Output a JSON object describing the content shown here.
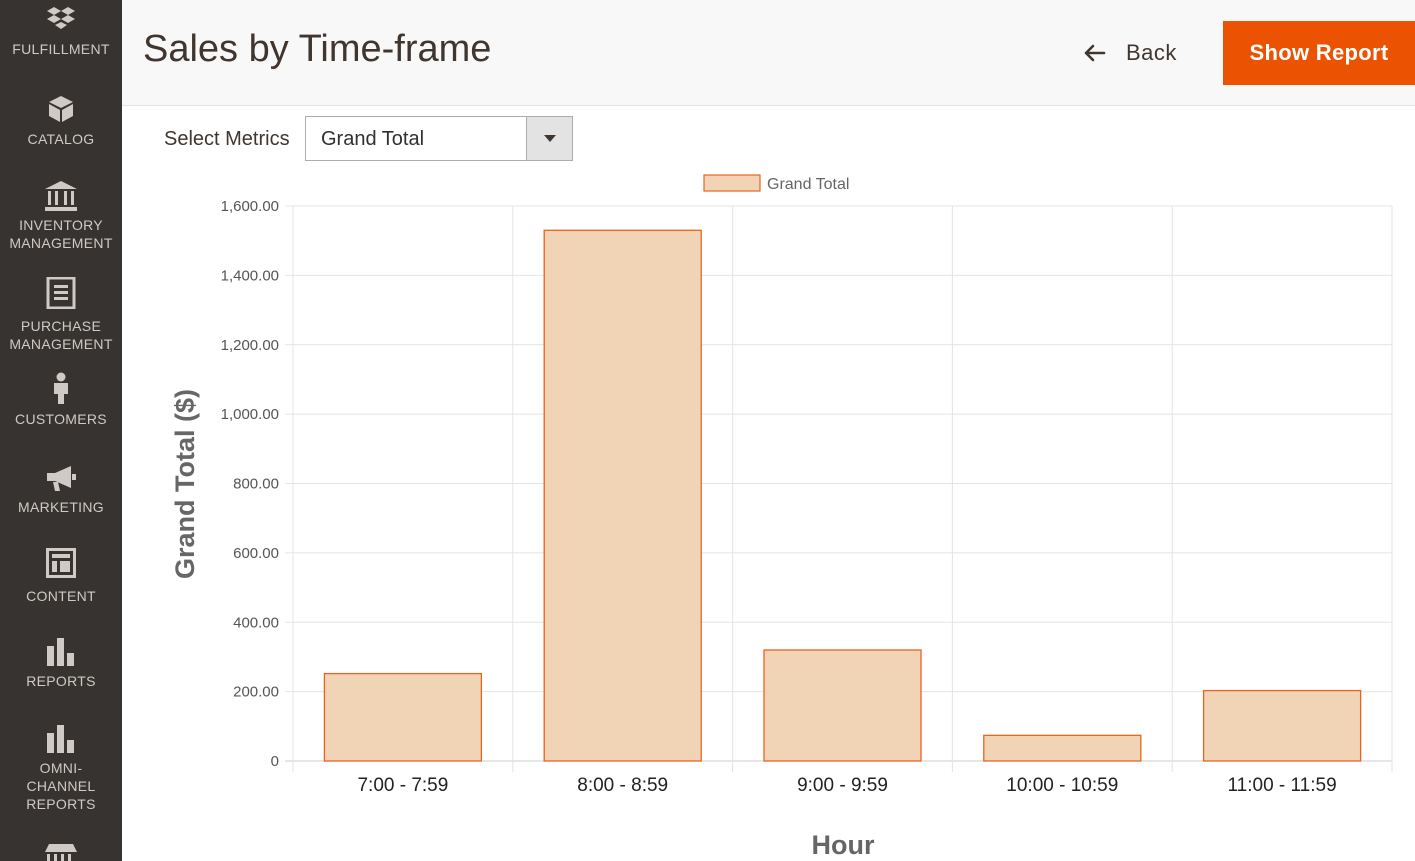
{
  "sidebar": {
    "items": [
      {
        "label": "FULFILLMENT",
        "icon": "box-stack-icon"
      },
      {
        "label": "CATALOG",
        "icon": "cube-icon"
      },
      {
        "label": "INVENTORY\nMANAGEMENT",
        "icon": "bank-icon"
      },
      {
        "label": "PURCHASE\nMANAGEMENT",
        "icon": "document-icon"
      },
      {
        "label": "CUSTOMERS",
        "icon": "person-icon"
      },
      {
        "label": "MARKETING",
        "icon": "megaphone-icon"
      },
      {
        "label": "CONTENT",
        "icon": "layout-icon"
      },
      {
        "label": "REPORTS",
        "icon": "bar-chart-icon"
      },
      {
        "label": "OMNI-\nCHANNEL\nREPORTS",
        "icon": "bar-chart-icon"
      },
      {
        "label": "",
        "icon": "store-icon"
      }
    ]
  },
  "header": {
    "title": "Sales by Time-frame",
    "back_label": "Back",
    "show_report_label": "Show Report"
  },
  "metrics": {
    "label": "Select Metrics",
    "selected": "Grand Total"
  },
  "colors": {
    "accent": "#eb5202",
    "sidebar_bg": "#373330",
    "bar_fill": "#f0d4b5",
    "bar_stroke": "#e8641e"
  },
  "chart_data": {
    "type": "bar",
    "categories": [
      "7:00 - 7:59",
      "8:00 - 8:59",
      "9:00 - 9:59",
      "10:00 - 10:59",
      "11:00 - 11:59"
    ],
    "series": [
      {
        "name": "Grand Total",
        "values": [
          252,
          1530,
          320,
          74,
          203
        ]
      }
    ],
    "xlabel": "Hour",
    "ylabel": "Grand Total ($)",
    "ylim": [
      0,
      1600
    ],
    "yticks": [
      "0",
      "200.00",
      "400.00",
      "600.00",
      "800.00",
      "1,000.00",
      "1,200.00",
      "1,400.00",
      "1,600.00"
    ],
    "grid": true,
    "legend": "top-center"
  }
}
